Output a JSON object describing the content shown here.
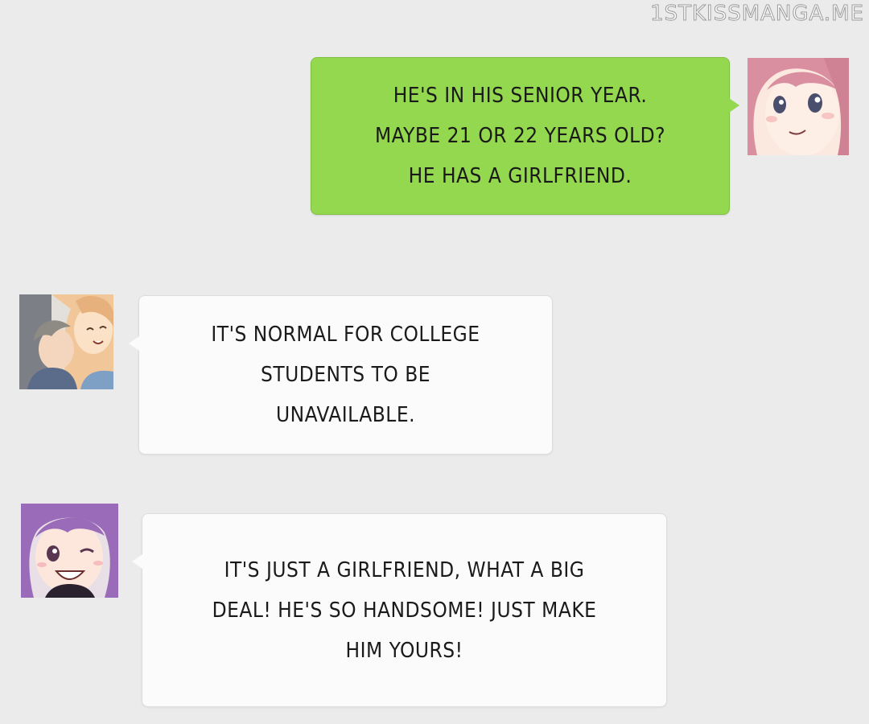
{
  "watermark": "1STKISSMANGA.ME",
  "messages": [
    {
      "side": "right",
      "bubble_color": "#93d84e",
      "avatar": "pink-hair-girl-avatar",
      "lines": [
        "HE'S IN HIS SENIOR YEAR.",
        "MAYBE 21 OR 22 YEARS OLD?",
        "HE HAS A GIRLFRIEND."
      ]
    },
    {
      "side": "left",
      "bubble_color": "#fbfbfb",
      "avatar": "couple-avatar",
      "lines": [
        "IT'S NORMAL FOR COLLEGE",
        "STUDENTS TO BE",
        "UNAVAILABLE."
      ]
    },
    {
      "side": "left",
      "bubble_color": "#fbfbfb",
      "avatar": "purple-hair-girl-winking-avatar",
      "lines": [
        "IT'S JUST A GIRLFRIEND, WHAT A BIG",
        "DEAL! HE'S SO HANDSOME! JUST MAKE",
        "HIM YOURS!"
      ]
    }
  ],
  "colors": {
    "background": "#ebebeb",
    "sent_bubble": "#93d84e",
    "received_bubble": "#fbfbfb"
  }
}
